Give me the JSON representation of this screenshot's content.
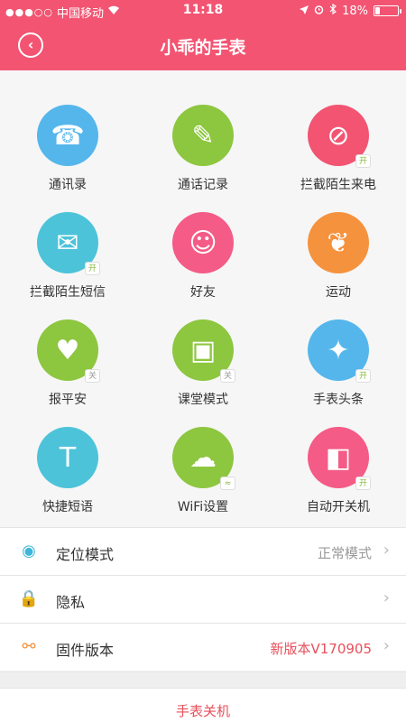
{
  "status_bar": {
    "signal": "●●●○○",
    "carrier": "中国移动",
    "wifi_icon": "wifi-icon",
    "time": "11:18",
    "battery": "18%",
    "battery_level": 0.18
  },
  "header": {
    "back_icon": "chevron-left-icon",
    "title": "小乖的手表",
    "color": "#f25472"
  },
  "grid_items": [
    {
      "label": "通讯录",
      "icon": "phone-book-icon",
      "color": "#55b6ec",
      "glyph": "☎",
      "tag": ""
    },
    {
      "label": "通话记录",
      "icon": "call-log-icon",
      "color": "#8dc63f",
      "glyph": "✎",
      "tag": ""
    },
    {
      "label": "拦截陌生来电",
      "icon": "block-call-icon",
      "color": "#f25472",
      "glyph": "⊘",
      "tag": "开"
    },
    {
      "label": "拦截陌生短信",
      "icon": "block-sms-icon",
      "color": "#4cc3d9",
      "glyph": "✉",
      "tag": "开"
    },
    {
      "label": "好友",
      "icon": "friends-icon",
      "color": "#f45b86",
      "glyph": "☺",
      "tag": ""
    },
    {
      "label": "运动",
      "icon": "footprints-icon",
      "color": "#f5923e",
      "glyph": "❦",
      "tag": ""
    },
    {
      "label": "报平安",
      "icon": "safe-heart-icon",
      "color": "#8dc63f",
      "glyph": "♥",
      "tag": "关"
    },
    {
      "label": "课堂模式",
      "icon": "class-mode-icon",
      "color": "#8dc63f",
      "glyph": "▣",
      "tag": "关"
    },
    {
      "label": "手表头条",
      "icon": "news-icon",
      "color": "#55b6ec",
      "glyph": "✦",
      "tag": "开"
    },
    {
      "label": "快捷短语",
      "icon": "quick-text-icon",
      "color": "#4cc3d9",
      "glyph": "T",
      "tag": ""
    },
    {
      "label": "WiFi设置",
      "icon": "wifi-settings-icon",
      "color": "#8dc63f",
      "glyph": "☁",
      "tag": "wifi"
    },
    {
      "label": "自动开关机",
      "icon": "auto-power-icon",
      "color": "#f45b86",
      "glyph": "◧",
      "tag": "开"
    }
  ],
  "settings": [
    {
      "label": "定位模式",
      "icon": "location-mode-icon",
      "glyph": "◉",
      "value": "正常模式",
      "value_color": "gray"
    },
    {
      "label": "隐私",
      "icon": "lock-icon",
      "glyph": "🔒",
      "value": "",
      "value_color": "gray"
    },
    {
      "label": "固件版本",
      "icon": "share-nodes-icon",
      "glyph": "⚯",
      "value": "新版本V170905",
      "value_color": "red"
    }
  ],
  "shutdown_label": "手表关机"
}
